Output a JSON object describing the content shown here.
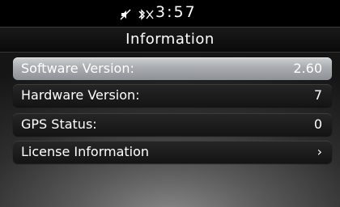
{
  "status_bar": {
    "time": "3:57",
    "icons": [
      "mute-icon",
      "bluetooth-icon"
    ]
  },
  "header": {
    "title": "Information"
  },
  "items": [
    {
      "label": "Software Version:",
      "value": "2.60",
      "selected": true
    },
    {
      "label": "Hardware Version:",
      "value": "7"
    },
    {
      "label": "GPS Status:",
      "value": "0"
    },
    {
      "label": "License Information",
      "chevron": "›"
    }
  ],
  "colors": {
    "selected_row": "#a8abaf",
    "row": "#1c1c1c",
    "text": "#ffffff"
  }
}
